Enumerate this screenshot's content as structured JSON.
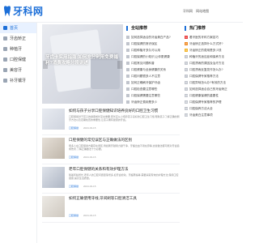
{
  "header": {
    "logo_text": "牙科网",
    "links": [
      "牙科网",
      "网站地图"
    ]
  },
  "sidebar": {
    "items": [
      {
        "label": "首页",
        "active": true
      },
      {
        "label": "牙齿矫正",
        "active": false
      },
      {
        "label": "种植牙",
        "active": false
      },
      {
        "label": "口腔保健",
        "active": false
      },
      {
        "label": "美容牙",
        "active": false
      },
      {
        "label": "补牙镶牙",
        "active": false
      }
    ]
  },
  "carousel": {
    "title": "牙齿卡实用指南:如何充分利用免费福利?消费攻略分段讲述"
  },
  "latest": {
    "title": "全站推荐",
    "items": [
      "如何选择适合的牙齿美白产品?",
      "口腔保健的常识误区",
      "口腔种植牙多久可以用",
      "口腔保健的小知识,让你更健康",
      "口腔常见问题科普",
      "口腔健康与全身健康的关系",
      "口腔问题很多人不注意",
      "如何正确刷牙保护牙齿",
      "口腔检查要注意哪些",
      "口腔保健需要注意哪些",
      "牙齿矫正费用是多少"
    ]
  },
  "hot": {
    "title": "热门推荐",
    "items": [
      "看牙医的牙科方案技巧",
      "牙齿矫正选择什么方式好?",
      "牙齿矫正的费用是多少钱",
      "种植牙的适应症和保养方法",
      "口腔溃疡的原因及治疗方法",
      "口腔溃疡反复发作怎么办?",
      "口腔保健专家推荐方法",
      "口腔异味怎么办?有效的方法",
      "如何选择适合自己的牙齿矫正",
      "口腔健康保健的重要性",
      "口腔保健专家推荐的护理",
      "口腔保养方法大全",
      "牙齿美白注意事项"
    ]
  },
  "articles": [
    {
      "title": "如何与孩子分享口腔保健知识培养良好的口腔卫生习惯",
      "desc": "口腔保健对于孩子的健康成长至关重要,家长应从小培养孩子良好的口腔卫生习惯,帮助孩子了解正确的刷牙方法以及定期检查的重要性,让孩子拥有健康的牙齿。",
      "category": "口腔保健",
      "date": "2024-03-15"
    },
    {
      "title": "口腔保健的常见误区与正确做法的区别",
      "desc": "很多人在口腔保健方面存在误区,例如刷牙越用力越干净、牙龈出血不用在意等,这些做法都可能对牙齿造成伤害,了解正确做法十分必要。",
      "category": "口腔保健",
      "date": "2024-03-15"
    },
    {
      "title": "老年口腔保健的关系和有效护理方法",
      "desc": "随着年龄增长,老年人的口腔问题逐渐增多,如牙齿松动、牙龈萎缩等,需要采取有效的护理方法,保持口腔健康,提高生活质量。",
      "category": "口腔保健",
      "date": "2024-03-15"
    },
    {
      "title": "如何正确使用牙线,牙间刷等口腔清洁工具",
      "desc": "",
      "category": "口腔保健",
      "date": "2024-03-15"
    }
  ],
  "colors": {
    "accent": "#1c6fd8",
    "rank1": "#e94040",
    "rank2": "#f08a24",
    "rank3": "#f3b42a"
  }
}
